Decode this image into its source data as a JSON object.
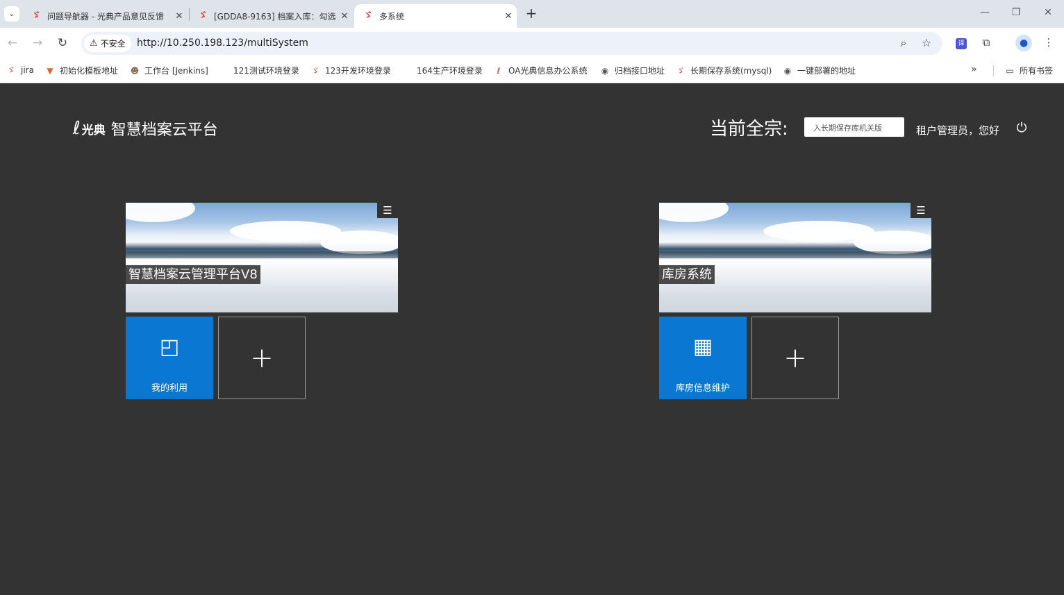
{
  "browser": {
    "tabs": [
      {
        "title": "问题导航器 - 光典产品意见反馈",
        "active": false
      },
      {
        "title": "[GDDA8-9163] 档案入库：勾选",
        "active": false
      },
      {
        "title": "多系统",
        "active": true
      }
    ],
    "security_label": "不安全",
    "url": "http://10.250.198.123/multiSystem",
    "bookmarks": [
      "jira",
      "初始化模板地址",
      "工作台 [Jenkins]",
      "121测试环境登录",
      "123开发环境登录",
      "164生产环境登录",
      "OA光典信息办公系统",
      "归档接口地址",
      "长期保存系统(mysql)",
      "一键部署的地址"
    ],
    "all_bookmarks": "所有书签"
  },
  "header": {
    "brand": "光典",
    "platform_name": "智慧档案云平台",
    "fonds_label": "当前全宗:",
    "fonds_value": "入长期保存库机关版",
    "greeting": "租户管理员，您好"
  },
  "systems": [
    {
      "title": "智慧档案云管理平台V8",
      "tiles": [
        {
          "label": "我的利用",
          "icon": "document-user-icon"
        }
      ]
    },
    {
      "title": "库房系统",
      "tiles": [
        {
          "label": "库房信息维护",
          "icon": "building-icon"
        }
      ]
    }
  ],
  "colors": {
    "page_bg": "#333333",
    "tile_blue": "#0a78d2",
    "tab_bar": "#dfe3ea"
  }
}
